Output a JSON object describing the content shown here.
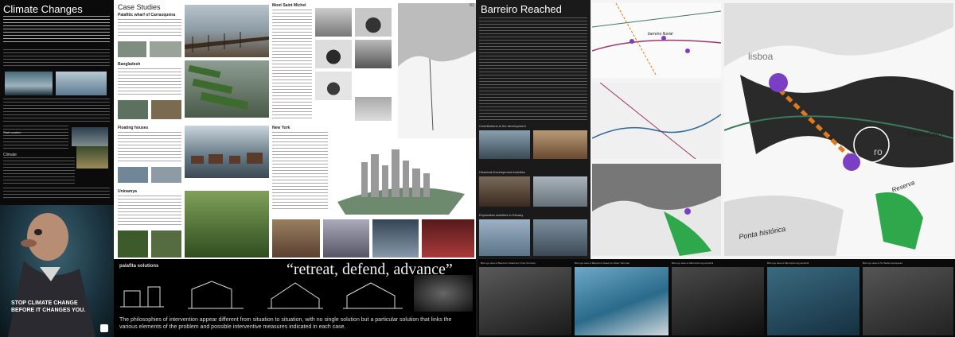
{
  "climate": {
    "title": "Climate Changes",
    "section_start": "Start caution",
    "section_climate": "Climate",
    "poster_line1": "STOP CLIMATE CHANGE",
    "poster_line2": "BEFORE IT CHANGES YOU."
  },
  "case_studies": {
    "title": "Case Studies",
    "items": [
      "Palafitic wharf of Carrasqueira",
      "Bangladesh",
      "Floating houses",
      "Uninamya",
      "Mont Saint Michel",
      "New York"
    ]
  },
  "bottom_strip": {
    "palafita_title": "palafita solutions",
    "headline": "“retreat, defend, advance”",
    "caption": "The philosophies of intervention appear different from situation to situation, with no single solution but a particular solution that links the various elements of the problem and possible interventive measures indicated in each case."
  },
  "barreiro": {
    "title": "Barreiro Reached",
    "sub1": "Contributions to the development",
    "sub2": "Historical Development Activities",
    "sub3": "Exploration activities in Estuary"
  },
  "maps": {
    "label_lisboa": "lisboa",
    "label_ro": "ro",
    "label_futuro_cbd": "futuro CBD",
    "label_ponta": "Ponta histórica",
    "label_reserva": "Reserva",
    "label_barreiro": "barreiro fluvial",
    "page_num": "01"
  },
  "bird_eye": [
    "Bird eye view of Barreiro's Road Iron Train Terminal",
    "Bird eye view of Barreiro's Road Iron River Terminal",
    "Bird eye view of Alburrica's leg windmill",
    "Bird eye view of Alburrica's leg windmill",
    "Bird eye view of St. Barão Quinqueiro"
  ],
  "colors": {
    "accent_purple": "#7b3fc4",
    "accent_orange": "#e07a1a",
    "accent_green": "#2ea84a"
  }
}
